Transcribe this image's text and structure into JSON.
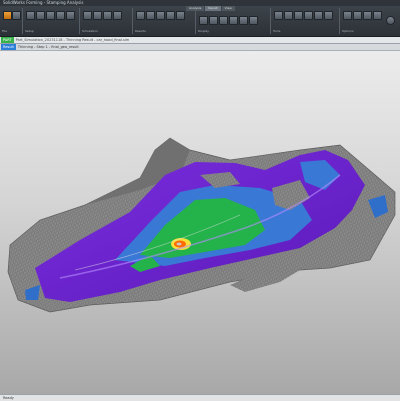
{
  "window": {
    "title": "SolidWorks Forming - Stamping Analysis"
  },
  "ribbon": {
    "tabs": [
      "Analysis",
      "Result",
      "View"
    ],
    "active_tab": "Result",
    "groups": [
      "File",
      "Setup",
      "Simulation",
      "Results",
      "Display",
      "Tools",
      "Options"
    ]
  },
  "document": {
    "tag": "PART",
    "path": "Part_Simulation_20231118 - Thinning Result - car_hood_final.sim"
  },
  "results_bar": {
    "tag": "Result",
    "text": "Thinning - Step 1 - final_geo_result"
  },
  "status": {
    "text": "Ready"
  },
  "colors": {
    "accent_green": "#37b24a",
    "accent_blue": "#2b7fd8",
    "map_purple": "#6a1fd0",
    "map_blue": "#3a78d6",
    "map_green": "#24b24a",
    "map_orange": "#ff6a00",
    "map_yellow": "#f5e03a",
    "mesh_gray": "#8e8e8e"
  }
}
